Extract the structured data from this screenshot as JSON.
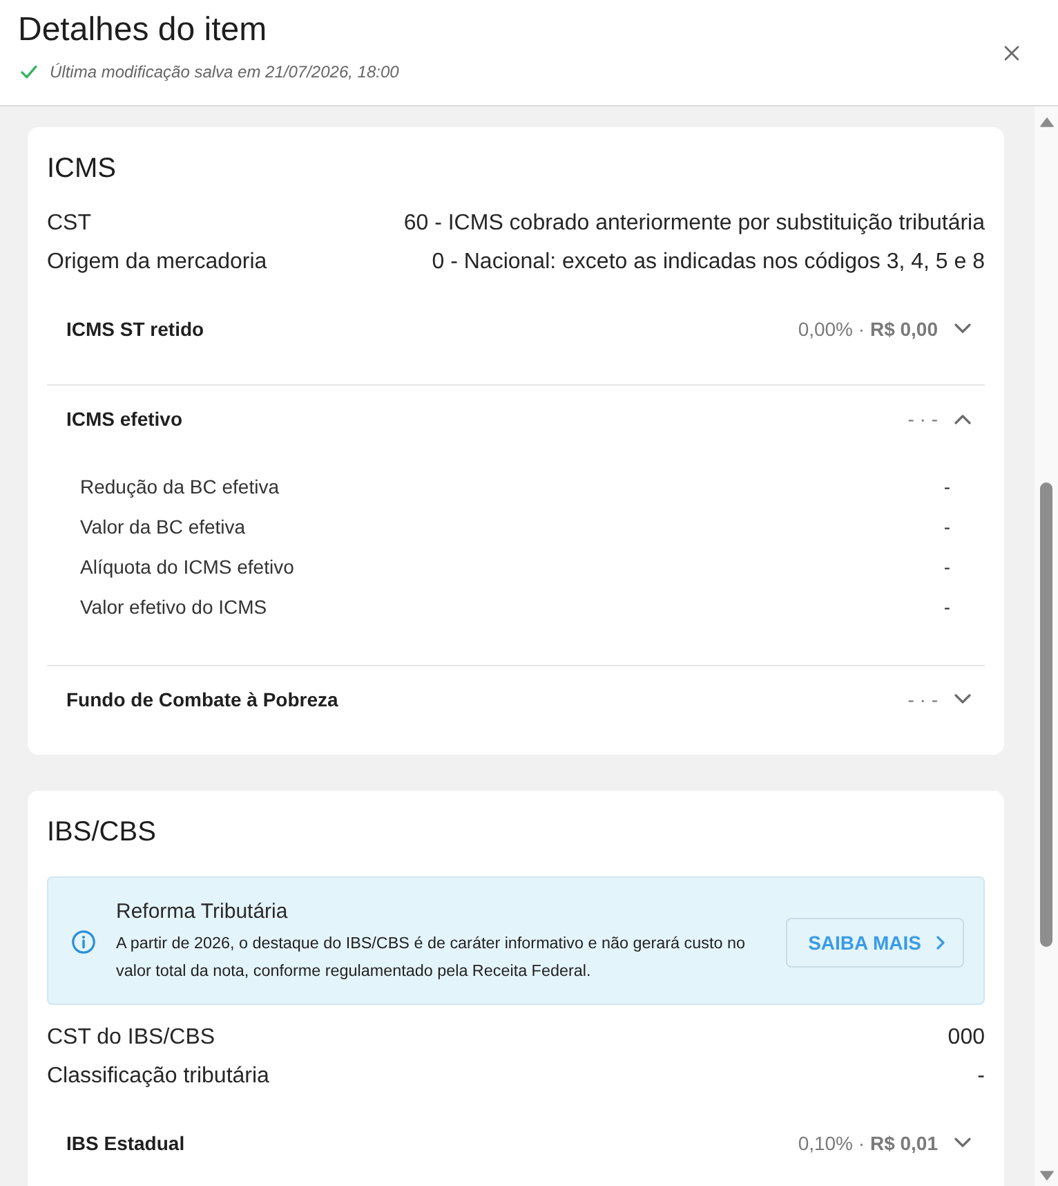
{
  "header": {
    "title": "Detalhes do item",
    "saved_status": "Última modificação salva em 21/07/2026, 18:00"
  },
  "sections": [
    {
      "title": "ICMS",
      "fields": [
        {
          "label": "CST",
          "value": "60 - ICMS cobrado anteriormente por substituição tributária"
        },
        {
          "label": "Origem da mercadoria",
          "value": "0 - Nacional: exceto as indicadas nos códigos 3, 4, 5 e 8"
        }
      ],
      "groups": [
        {
          "title": "ICMS ST retido",
          "summary": "0,00% · **R$ 0,00**",
          "expanded": false
        },
        {
          "title": "ICMS efetivo",
          "summary": "- · -",
          "expanded": true,
          "rows": [
            {
              "label": "Redução da BC efetiva",
              "value": "-"
            },
            {
              "label": "Valor da BC efetiva",
              "value": "-"
            },
            {
              "label": "Alíquota do ICMS efetivo",
              "value": "-"
            },
            {
              "label": "Valor efetivo do ICMS",
              "value": "-"
            }
          ]
        },
        {
          "title": "Fundo de Combate à Pobreza",
          "summary": "- · -",
          "expanded": false
        }
      ]
    },
    {
      "title": "IBS/CBS",
      "notice": {
        "title": "Reforma Tributária",
        "text": "A partir de 2026, o destaque do IBS/CBS é de caráter informativo e não gerará custo no valor total da nota, conforme regulamentado pela Receita Federal.",
        "button": "SAIBA MAIS"
      },
      "fields": [
        {
          "label": "CST do IBS/CBS",
          "value": "000"
        },
        {
          "label": "Classificação tributária",
          "value": "-"
        }
      ],
      "groups": [
        {
          "title": "IBS Estadual",
          "summary": "0,10% · **R$ 0,01**",
          "expanded": false
        }
      ]
    }
  ]
}
